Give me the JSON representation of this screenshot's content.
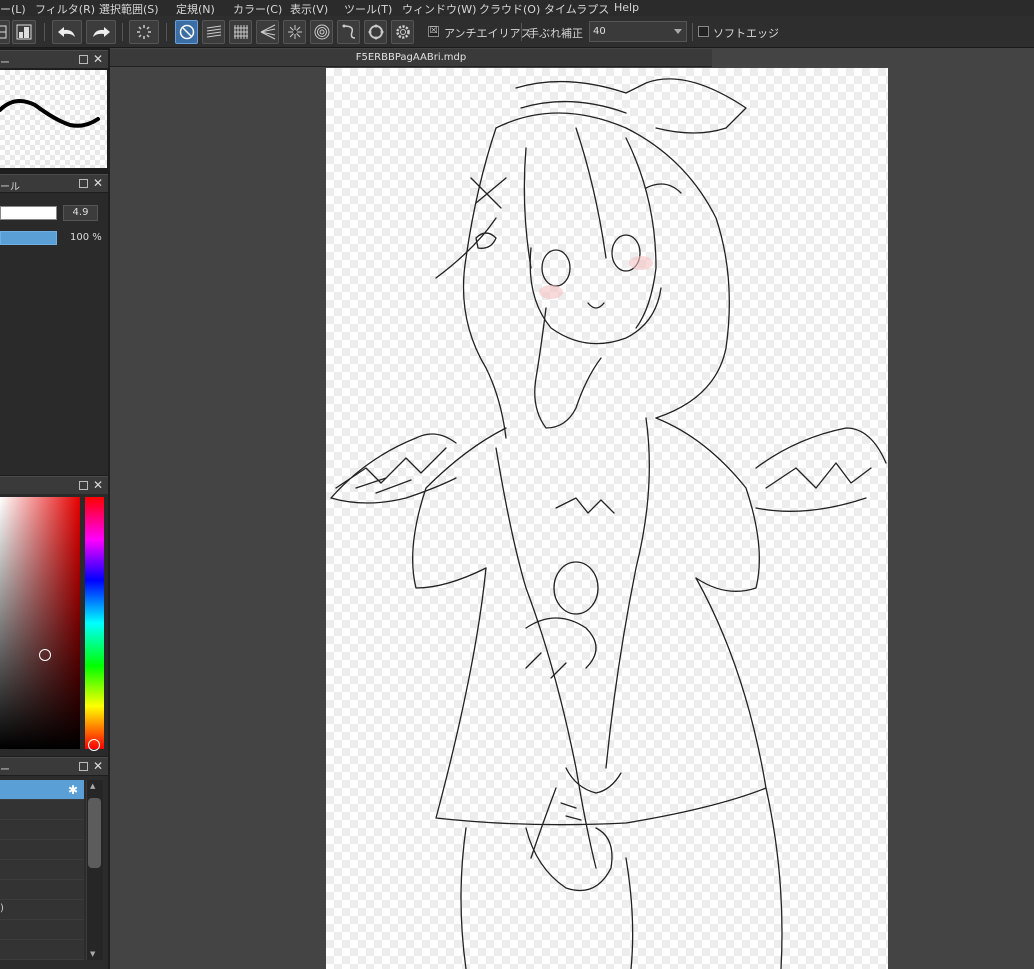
{
  "menu": {
    "items": [
      "ー(L)",
      "フィルタ(R)",
      "選択範囲(S)",
      "定規(N)",
      "カラー(C)",
      "表示(V)",
      "ツール(T)",
      "ウィンドウ(W)",
      "クラウド(O)",
      "タイムラプス",
      "Help"
    ]
  },
  "toolbar": {
    "antialias_label": "アンチエイリアス",
    "antialias_checked": "☒",
    "stabilizer_label": "手ぶれ補正",
    "stabilizer_value": "40",
    "soft_edge_label": "ソフトエッジ",
    "icons": [
      "grid-icon",
      "layout-icon",
      "undo-icon",
      "redo-icon",
      "loading-icon",
      "snap-off-icon",
      "parallel-snap-icon",
      "grid-snap-icon",
      "vanishing-snap-icon",
      "radial-snap-icon",
      "circle-snap-icon",
      "curve-snap-icon",
      "ellipse-snap-icon",
      "snap-settings-icon"
    ]
  },
  "panels": {
    "brush_preview_title": "ー",
    "brush_control_title": "ール",
    "brush_size": "4.9",
    "brush_opacity": "100 %",
    "color_title": "",
    "layer_title": "ー",
    "layer_partial_label": ")"
  },
  "document": {
    "tab_title": "F5ERBBPagAABri.mdp"
  },
  "colors": {
    "accent": "#5a9fd6",
    "panel_bg": "#2a2a2a",
    "doc_bg": "#444444"
  }
}
